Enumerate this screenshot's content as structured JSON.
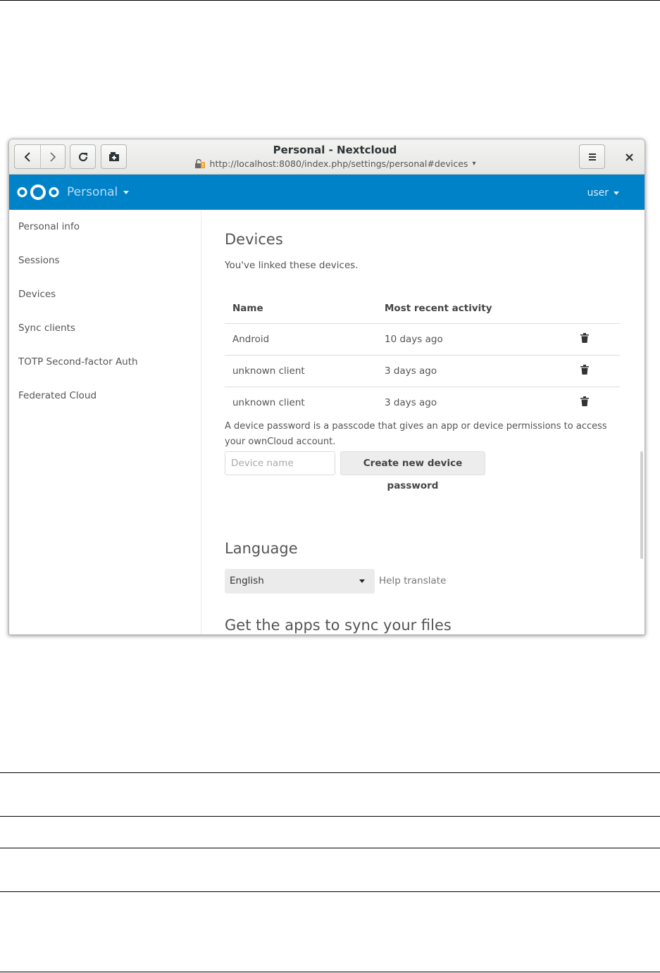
{
  "window": {
    "title": "Personal - Nextcloud",
    "url": "http://localhost:8080/index.php/settings/personal#devices",
    "url_dropdown": "▾"
  },
  "header": {
    "app_name": "Personal",
    "user": "user",
    "brand_color": "#0082c9"
  },
  "sidebar": {
    "items": [
      {
        "label": "Personal info"
      },
      {
        "label": "Sessions"
      },
      {
        "label": "Devices"
      },
      {
        "label": "Sync clients"
      },
      {
        "label": "TOTP Second-factor Auth"
      },
      {
        "label": "Federated Cloud"
      }
    ]
  },
  "devices": {
    "heading": "Devices",
    "intro": "You've linked these devices.",
    "columns": [
      "Name",
      "Most recent activity"
    ],
    "rows": [
      {
        "name": "Android",
        "activity": "10 days ago"
      },
      {
        "name": "unknown client",
        "activity": "3 days ago"
      },
      {
        "name": "unknown client",
        "activity": "3 days ago"
      }
    ],
    "note_line1": "A device password is a passcode that gives an app or device permissions to access",
    "note_line2": "your ownCloud account.",
    "name_placeholder": "Device name",
    "create_button": "Create new device password"
  },
  "language": {
    "heading": "Language",
    "selected": "English",
    "help_link": "Help translate"
  },
  "apps": {
    "heading": "Get the apps to sync your files"
  },
  "icons": {
    "back": "back-arrow-icon",
    "forward": "forward-arrow-icon",
    "reload": "reload-icon",
    "new_tab": "new-tab-icon",
    "menu": "hamburger-menu-icon",
    "close": "close-icon",
    "lock": "insecure-lock-icon",
    "logo": "nextcloud-logo-icon",
    "trash": "trash-icon"
  }
}
